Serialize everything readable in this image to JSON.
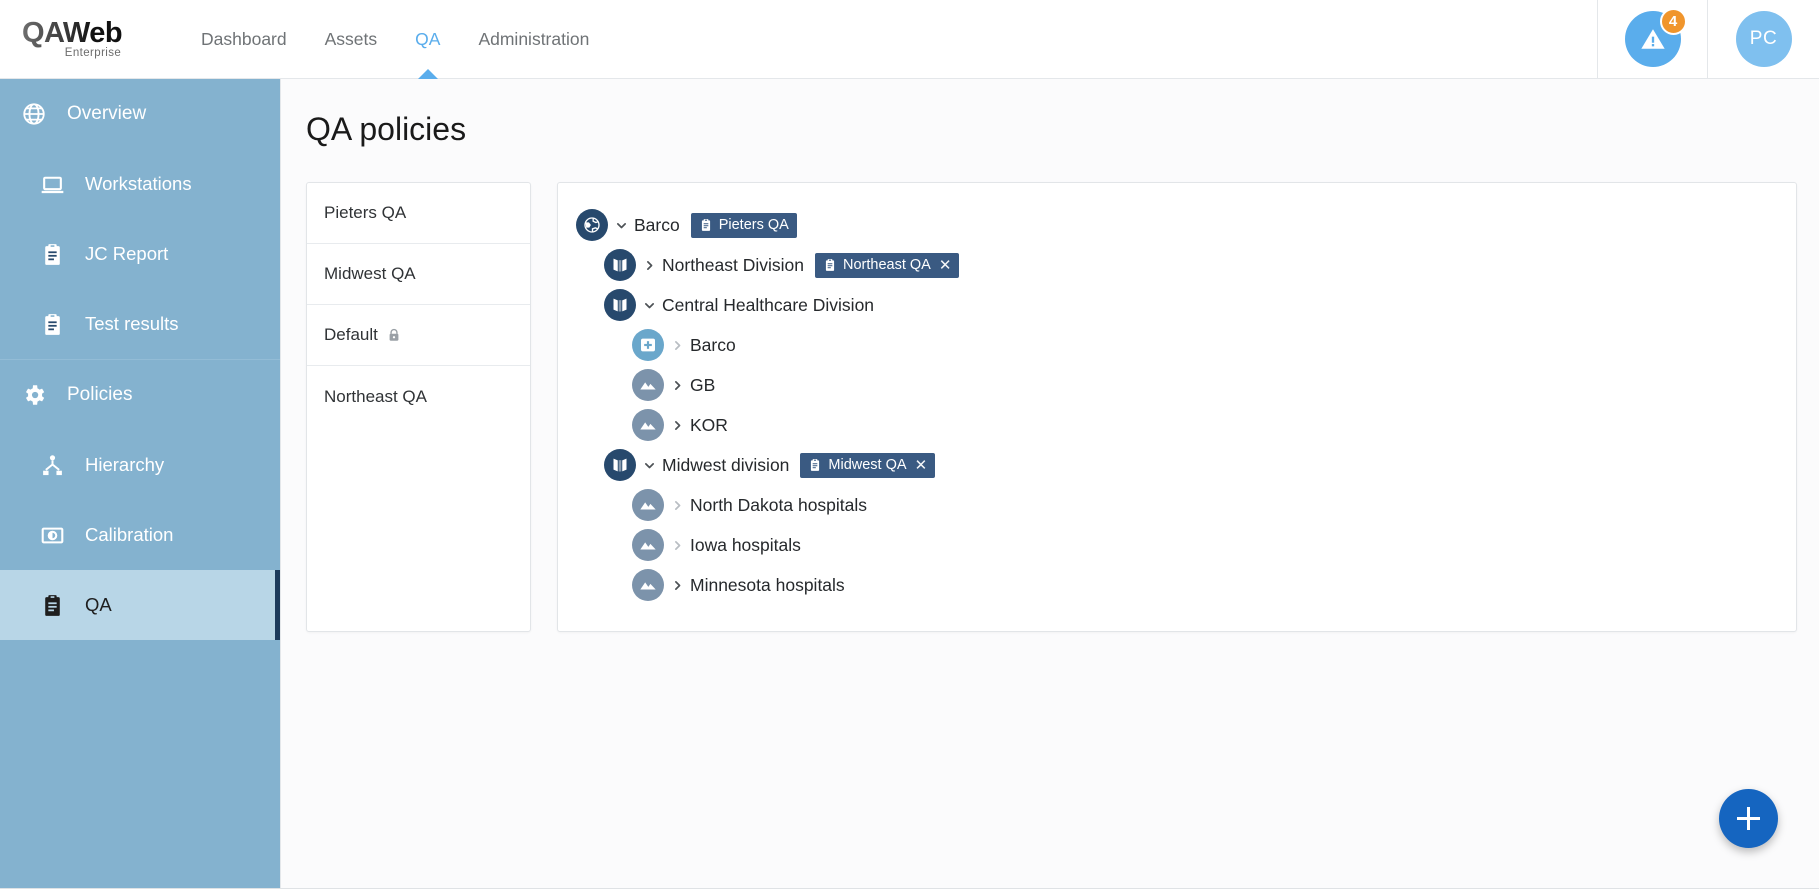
{
  "app": {
    "logo_main": "QAWeb",
    "logo_sub": "Enterprise"
  },
  "topnav": {
    "items": [
      {
        "label": "Dashboard",
        "active": false
      },
      {
        "label": "Assets",
        "active": false
      },
      {
        "label": "QA",
        "active": true
      },
      {
        "label": "Administration",
        "active": false
      }
    ],
    "alert_icon": "warning-triangle-icon",
    "alert_count": "4",
    "avatar_initials": "PC"
  },
  "sidebar": {
    "items": [
      {
        "label": "Overview",
        "icon": "globe-icon",
        "level": 0,
        "active": false
      },
      {
        "label": "Workstations",
        "icon": "laptop-icon",
        "level": 1,
        "active": false
      },
      {
        "label": "JC Report",
        "icon": "clipboard-icon",
        "level": 1,
        "active": false
      },
      {
        "label": "Test results",
        "icon": "clipboard-icon",
        "level": 1,
        "active": false
      },
      {
        "label": "Policies",
        "icon": "gear-icon",
        "level": 0,
        "active": false
      },
      {
        "label": "Hierarchy",
        "icon": "hierarchy-icon",
        "level": 1,
        "active": false
      },
      {
        "label": "Calibration",
        "icon": "calibration-icon",
        "level": 1,
        "active": false
      },
      {
        "label": "QA",
        "icon": "clipboard-icon",
        "level": 1,
        "active": true
      }
    ]
  },
  "main": {
    "page_title": "QA policies",
    "policy_list": [
      {
        "label": "Pieters QA",
        "locked": false
      },
      {
        "label": "Midwest QA",
        "locked": false
      },
      {
        "label": "Default",
        "locked": true
      },
      {
        "label": "Northeast QA",
        "locked": false
      }
    ],
    "tree": [
      {
        "label": "Barco",
        "icon": "globe-node-icon",
        "icon_style": "navy",
        "indent": 0,
        "expanded": true,
        "chevron": "down",
        "chevron_dim": false,
        "tag": {
          "label": "Pieters QA",
          "icon": "clipboard-icon",
          "removable": false
        }
      },
      {
        "label": "Northeast Division",
        "icon": "map-icon",
        "icon_style": "navy",
        "indent": 1,
        "expanded": false,
        "chevron": "right",
        "chevron_dim": false,
        "tag": {
          "label": "Northeast QA",
          "icon": "clipboard-icon",
          "removable": true
        }
      },
      {
        "label": "Central Healthcare Division",
        "icon": "map-icon",
        "icon_style": "navy",
        "indent": 1,
        "expanded": true,
        "chevron": "down",
        "chevron_dim": false,
        "tag": null
      },
      {
        "label": "Barco",
        "icon": "hospital-icon",
        "icon_style": "lblue",
        "indent": 2,
        "expanded": false,
        "chevron": "right",
        "chevron_dim": true,
        "tag": null
      },
      {
        "label": "GB",
        "icon": "region-icon",
        "icon_style": "slate",
        "indent": 2,
        "expanded": false,
        "chevron": "right",
        "chevron_dim": false,
        "tag": null
      },
      {
        "label": "KOR",
        "icon": "region-icon",
        "icon_style": "slate",
        "indent": 2,
        "expanded": false,
        "chevron": "right",
        "chevron_dim": false,
        "tag": null
      },
      {
        "label": "Midwest division",
        "icon": "map-icon",
        "icon_style": "navy",
        "indent": 1,
        "expanded": true,
        "chevron": "down",
        "chevron_dim": false,
        "tag": {
          "label": "Midwest QA",
          "icon": "clipboard-icon",
          "removable": true
        }
      },
      {
        "label": "North Dakota hospitals",
        "icon": "region-icon",
        "icon_style": "slate",
        "indent": 2,
        "expanded": false,
        "chevron": "right",
        "chevron_dim": true,
        "tag": null
      },
      {
        "label": "Iowa hospitals",
        "icon": "region-icon",
        "icon_style": "slate",
        "indent": 2,
        "expanded": false,
        "chevron": "right",
        "chevron_dim": true,
        "tag": null
      },
      {
        "label": "Minnesota hospitals",
        "icon": "region-icon",
        "icon_style": "slate",
        "indent": 2,
        "expanded": false,
        "chevron": "right",
        "chevron_dim": false,
        "tag": null
      }
    ],
    "fab": {
      "icon": "plus-icon"
    }
  },
  "colors": {
    "accent_blue": "#5aadec",
    "sidebar_bg": "#84b2cf",
    "sidebar_active_bg": "#b8d6e7",
    "sidebar_active_border": "#1d3b5c",
    "tag_bg": "#3a5a82",
    "node_navy": "#27496d",
    "node_light_blue": "#6aa7cb",
    "node_slate": "#7c93ab",
    "badge_orange": "#f0952c",
    "fab_blue": "#1565c0"
  }
}
